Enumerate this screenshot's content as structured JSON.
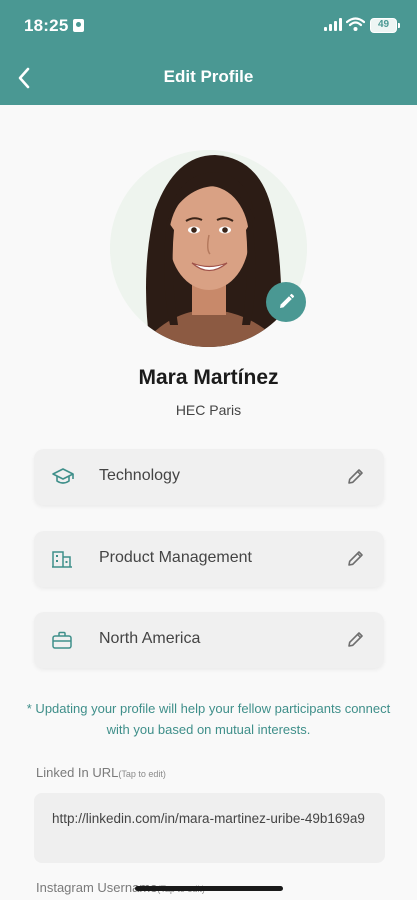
{
  "status_bar": {
    "time": "18:25",
    "battery": "49"
  },
  "header": {
    "title": "Edit Profile",
    "back_icon": "chevron-left-icon"
  },
  "profile": {
    "name": "Mara Martínez",
    "school": "HEC Paris"
  },
  "fields": [
    {
      "icon": "graduation-cap-icon",
      "label": "Technology"
    },
    {
      "icon": "building-icon",
      "label": "Product Management"
    },
    {
      "icon": "briefcase-icon",
      "label": "North America"
    }
  ],
  "note": "* Updating your profile will help your fellow participants connect with you based on mutual interests.",
  "linkedin": {
    "label": "Linked In URL",
    "hint": "(Tap to edit)",
    "value": "http://linkedin.com/in/mara-martinez-uribe-49b169a9"
  },
  "instagram": {
    "label": "Instagram Username",
    "hint": "(Tap to edit)"
  },
  "colors": {
    "brand": "#4a9893",
    "note_text": "#3f8f8a",
    "card_bg": "#f0f0f0"
  }
}
